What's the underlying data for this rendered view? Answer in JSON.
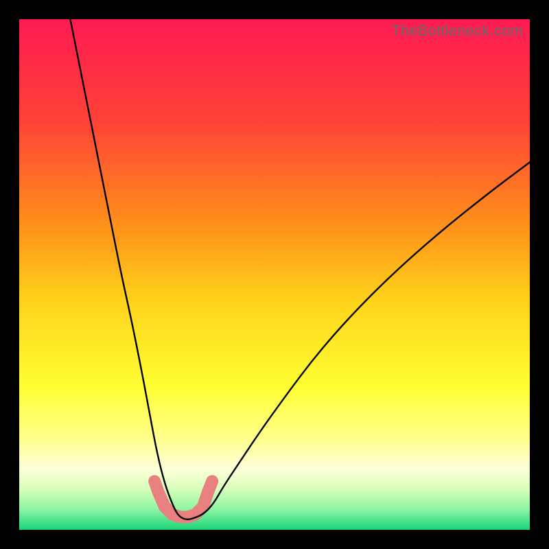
{
  "watermark": "TheBottleneck.com",
  "chart_data": {
    "type": "line",
    "title": "",
    "xlabel": "",
    "ylabel": "",
    "xlim": [
      0,
      100
    ],
    "ylim": [
      0,
      100
    ],
    "grid": false,
    "legend": false,
    "background_gradient": {
      "stops": [
        {
          "offset": 0.0,
          "color": "#ff1a52"
        },
        {
          "offset": 0.2,
          "color": "#ff4236"
        },
        {
          "offset": 0.4,
          "color": "#ff8f1a"
        },
        {
          "offset": 0.55,
          "color": "#ffd21a"
        },
        {
          "offset": 0.72,
          "color": "#ffff33"
        },
        {
          "offset": 0.82,
          "color": "#ffff8a"
        },
        {
          "offset": 0.88,
          "color": "#fdffd8"
        },
        {
          "offset": 0.92,
          "color": "#d8ffba"
        },
        {
          "offset": 0.96,
          "color": "#8cf5a2"
        },
        {
          "offset": 1.0,
          "color": "#1bd47a"
        }
      ]
    },
    "series": [
      {
        "name": "bottleneck-curve",
        "color": "#000000",
        "x": [
          10,
          12,
          14,
          16,
          18,
          20,
          22,
          24,
          25.5,
          27,
          28.5,
          30,
          31,
          32,
          33,
          34,
          36,
          38,
          40,
          43,
          47,
          52,
          58,
          65,
          73,
          82,
          92,
          100
        ],
        "y": [
          100,
          90,
          80,
          70,
          60,
          50,
          41,
          31,
          23,
          15,
          9,
          5,
          3,
          2.2,
          2,
          2.2,
          3,
          5,
          8.5,
          13,
          19,
          26,
          34,
          42,
          50,
          58,
          66,
          72
        ]
      },
      {
        "name": "bottom-markers",
        "color": "#e98080",
        "type": "scatter",
        "x": [
          26.5,
          27.2,
          28.5,
          30,
          31.5,
          33,
          34.5,
          36,
          37,
          37.8
        ],
        "y": [
          9.5,
          7.5,
          4.5,
          3,
          2.5,
          2.5,
          3,
          4.5,
          7.5,
          9.5
        ]
      }
    ],
    "note": "Axes carry no visible tick labels; x/y values are read proportionally from the 0–100 plotting area."
  }
}
